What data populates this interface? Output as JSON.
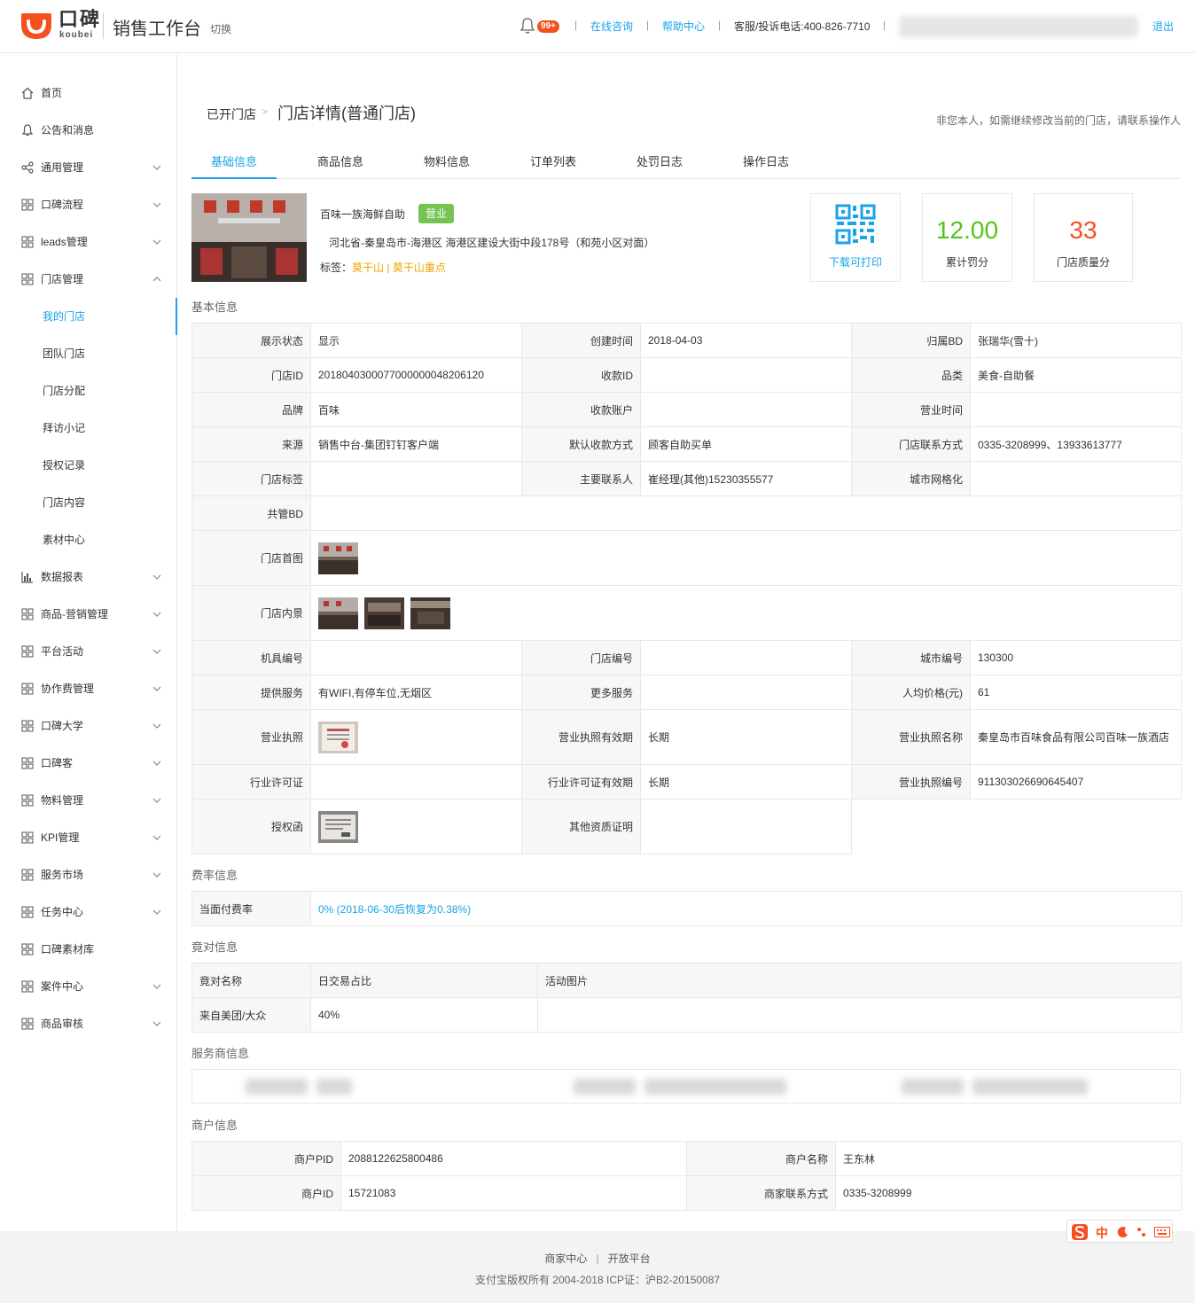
{
  "header": {
    "logo_text": "口碑",
    "logo_sub": "koubei",
    "app_title": "销售工作台",
    "switch_label": "切换",
    "notification_count": "99+",
    "online_consult": "在线咨询",
    "help_center": "帮助中心",
    "hotline": "客服/投诉电话:400-826-7710",
    "logout": "退出",
    "separator": "|"
  },
  "sidebar": {
    "items": [
      {
        "label": "首页",
        "icon": "home-icon",
        "has_chevron": false
      },
      {
        "label": "公告和消息",
        "icon": "bell-icon",
        "has_chevron": false
      },
      {
        "label": "通用管理",
        "icon": "share-icon",
        "has_chevron": true
      },
      {
        "label": "口碑流程",
        "icon": "grid-icon",
        "has_chevron": true
      },
      {
        "label": "leads管理",
        "icon": "grid-icon",
        "has_chevron": true
      },
      {
        "label": "门店管理",
        "icon": "grid-icon",
        "has_chevron": true,
        "expanded": true
      }
    ],
    "sub_items": [
      {
        "label": "我的门店",
        "active": true
      },
      {
        "label": "团队门店"
      },
      {
        "label": "门店分配"
      },
      {
        "label": "拜访小记"
      },
      {
        "label": "授权记录"
      },
      {
        "label": "门店内容"
      },
      {
        "label": "素材中心"
      }
    ],
    "items_after": [
      {
        "label": "数据报表",
        "icon": "chart-icon"
      },
      {
        "label": "商品-营销管理",
        "icon": "grid-icon"
      },
      {
        "label": "平台活动",
        "icon": "grid-icon"
      },
      {
        "label": "协作费管理",
        "icon": "grid-icon"
      },
      {
        "label": "口碑大学",
        "icon": "grid-icon"
      },
      {
        "label": "口碑客",
        "icon": "grid-icon"
      },
      {
        "label": "物料管理",
        "icon": "grid-icon"
      },
      {
        "label": "KPI管理",
        "icon": "grid-icon"
      },
      {
        "label": "服务市场",
        "icon": "grid-icon"
      },
      {
        "label": "任务中心",
        "icon": "grid-icon"
      },
      {
        "label": "口碑素材库",
        "icon": "grid-icon",
        "no_chevron": true
      },
      {
        "label": "案件中心",
        "icon": "grid-icon"
      },
      {
        "label": "商品审核",
        "icon": "grid-icon"
      }
    ]
  },
  "breadcrumb": {
    "parent": "已开门店",
    "separator": ">",
    "current": "门店详情(普通门店)"
  },
  "notice": "非您本人，如需继续修改当前的门店，请联系操作人",
  "tabs": [
    "基础信息",
    "商品信息",
    "物料信息",
    "订单列表",
    "处罚日志",
    "操作日志"
  ],
  "store": {
    "name": "百味一族海鲜自助",
    "status": "营业",
    "address": "河北省-秦皇岛市-海港区 海港区建设大街中段178号（和苑小区对面）",
    "tags_label": "标签：",
    "tags": [
      "莫干山",
      "莫干山重点"
    ],
    "tag_sep": "|"
  },
  "kpis": {
    "qr_caption": "下载可打印",
    "penalty_value": "12.00",
    "penalty_caption": "累计罚分",
    "quality_value": "33",
    "quality_caption": "门店质量分"
  },
  "sections": {
    "basic": "基本信息",
    "fee": "费率信息",
    "competitor": "竟对信息",
    "provider": "服务商信息",
    "merchant": "商户信息"
  },
  "basic_info": {
    "rows": [
      [
        [
          "展示状态",
          "显示"
        ],
        [
          "创建时间",
          "2018-04-03"
        ],
        [
          "归属BD",
          "张瑞华(雪十)"
        ]
      ],
      [
        [
          "门店ID",
          "2018040300077000000048206120"
        ],
        [
          "收款ID",
          ""
        ],
        [
          "品类",
          "美食-自助餐"
        ]
      ],
      [
        [
          "品牌",
          "百味"
        ],
        [
          "收款账户",
          ""
        ],
        [
          "营业时间",
          ""
        ]
      ],
      [
        [
          "来源",
          "销售中台-集团钉钉客户端"
        ],
        [
          "默认收款方式",
          "顾客自助买单"
        ],
        [
          "门店联系方式",
          "0335-3208999、13933613777"
        ]
      ],
      [
        [
          "门店标签",
          ""
        ],
        [
          "主要联系人",
          "崔经理(其他)15230355577"
        ],
        [
          "城市网格化",
          ""
        ]
      ]
    ],
    "shared_bd_label": "共管BD",
    "cover_label": "门店首图",
    "interior_label": "门店内景",
    "rows2": [
      [
        [
          "机具编号",
          ""
        ],
        [
          "门店编号",
          ""
        ],
        [
          "城市编号",
          "130300"
        ]
      ],
      [
        [
          "提供服务",
          "有WIFI,有停车位,无烟区"
        ],
        [
          "更多服务",
          ""
        ],
        [
          "人均价格(元)",
          "61"
        ]
      ]
    ],
    "license_label": "营业执照",
    "license_valid_label": "营业执照有效期",
    "license_valid": "长期",
    "license_name_label": "营业执照名称",
    "license_name": "秦皇岛市百味食品有限公司百味一族酒店",
    "permit_label": "行业许可证",
    "permit_valid_label": "行业许可证有效期",
    "permit_valid": "长期",
    "license_no_label": "营业执照编号",
    "license_no": "911303026690645407",
    "auth_label": "授权函",
    "other_cert_label": "其他资质证明"
  },
  "fee_info": {
    "label": "当面付费率",
    "value": "0% (2018-06-30后恢复为0.38%)"
  },
  "competitor_info": {
    "h1": "竟对名称",
    "h2": "日交易占比",
    "h3": "活动图片",
    "r1": "来自美团/大众",
    "r2": "40%"
  },
  "merchant_info": {
    "pid_label": "商户PID",
    "pid": "2088122625800486",
    "name_label": "商户名称",
    "name": "王东林",
    "id_label": "商户ID",
    "id": "15721083",
    "contact_label": "商家联系方式",
    "contact": "0335-3208999"
  },
  "footer": {
    "link1": "商家中心",
    "sep": "|",
    "link2": "开放平台",
    "copyright": "支付宝版权所有 2004-2018 ICP证：沪B2-20150087"
  },
  "ime": {
    "mode": "中"
  },
  "colors": {
    "accent": "#1aa3e8",
    "brand": "#f5511e",
    "status_green": "#75c453",
    "tag": "#f0a400",
    "kpi_green": "#52c41a",
    "kpi_orange": "#f5511e"
  }
}
